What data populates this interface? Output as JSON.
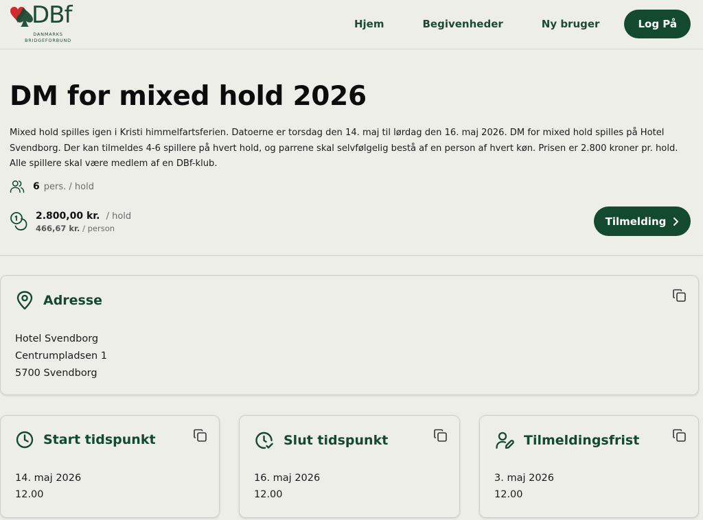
{
  "brand": {
    "logo_text": "DBf",
    "sub_line1": "DANMARKS",
    "sub_line2": "BRIDGEFORBUND"
  },
  "nav": {
    "items": [
      {
        "label": "Hjem"
      },
      {
        "label": "Begivenheder"
      },
      {
        "label": "Ny bruger"
      }
    ],
    "login_label": "Log På"
  },
  "event": {
    "title": "DM for mixed hold 2026",
    "description": "Mixed hold spilles igen i Kristi himmelfartsferien. Datoerne er torsdag den 14. maj til lørdag den 16. maj 2026. DM for mixed hold spilles på Hotel Svendborg. Der kan tilmeldes 4-6 spillere på hvert hold, og parrene skal selvfølgelig bestå af en person af hvert køn. Prisen er 2.800 kroner pr. hold. Alle spillere skal være medlem af en DBf-klub.",
    "persons_count": "6",
    "persons_unit": "pers. / hold",
    "price": "2.800,00 kr.",
    "price_unit": "/ hold",
    "price_person": "466,67 kr.",
    "price_person_unit": "/ person",
    "signup_label": "Tilmelding"
  },
  "address_card": {
    "title": "Adresse",
    "lines": [
      "Hotel Svendborg",
      "Centrumpladsen 1",
      "5700 Svendborg"
    ]
  },
  "start_card": {
    "title": "Start tidspunkt",
    "date": "14. maj 2026",
    "time": "12.00"
  },
  "end_card": {
    "title": "Slut tidspunkt",
    "date": "16. maj 2026",
    "time": "12.00"
  },
  "deadline_card": {
    "title": "Tilmeldingsfrist",
    "date": "3. maj 2026",
    "time": "12.00"
  },
  "icons": {
    "logo": "heart-spade-icon",
    "persons": "users-icon",
    "price": "coins-icon",
    "signup": "chevron-right-icon",
    "address": "map-pin-icon",
    "copy": "copy-icon",
    "start": "clock-icon",
    "end": "clock-check-icon",
    "deadline": "user-edit-icon"
  },
  "colors": {
    "primary": "#13492f",
    "background": "#eeeee9",
    "logo_red": "#d42a2f"
  }
}
